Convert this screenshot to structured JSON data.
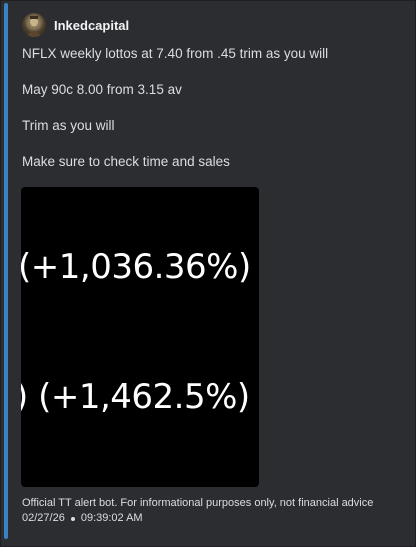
{
  "author": {
    "username": "Inkedcapital",
    "avatar_icon": "profile-avatar-icon"
  },
  "message": {
    "lines": [
      "NFLX weekly lottos at 7.40 from .45 trim as you will",
      "May 90c 8.00 from 3.15 av",
      "Trim as you will",
      "Make sure to check time and sales"
    ]
  },
  "image": {
    "line1": "(+1,036.36%)",
    "line2": ") (+1,462.5%)"
  },
  "footer": {
    "note": "Official TT alert bot. For informational purposes only, not financial advice",
    "date": "02/27/26",
    "time": "09:39:02 AM"
  },
  "colors": {
    "background": "#2b2d31",
    "accent_bar": "#3b82c4",
    "text": "#dbdee1",
    "username": "#f2f3f5",
    "image_bg": "#000000"
  }
}
